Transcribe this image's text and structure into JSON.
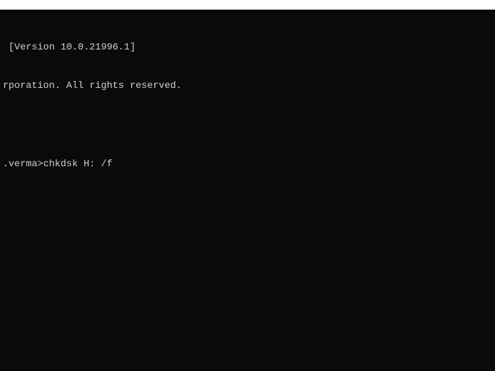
{
  "titlebar": {
    "title": ""
  },
  "terminal": {
    "banner_line1": " [Version 10.0.21996.1]",
    "banner_line2": "rporation. All rights reserved.",
    "prompt": ".verma>",
    "command": "chkdsk H: /f"
  }
}
